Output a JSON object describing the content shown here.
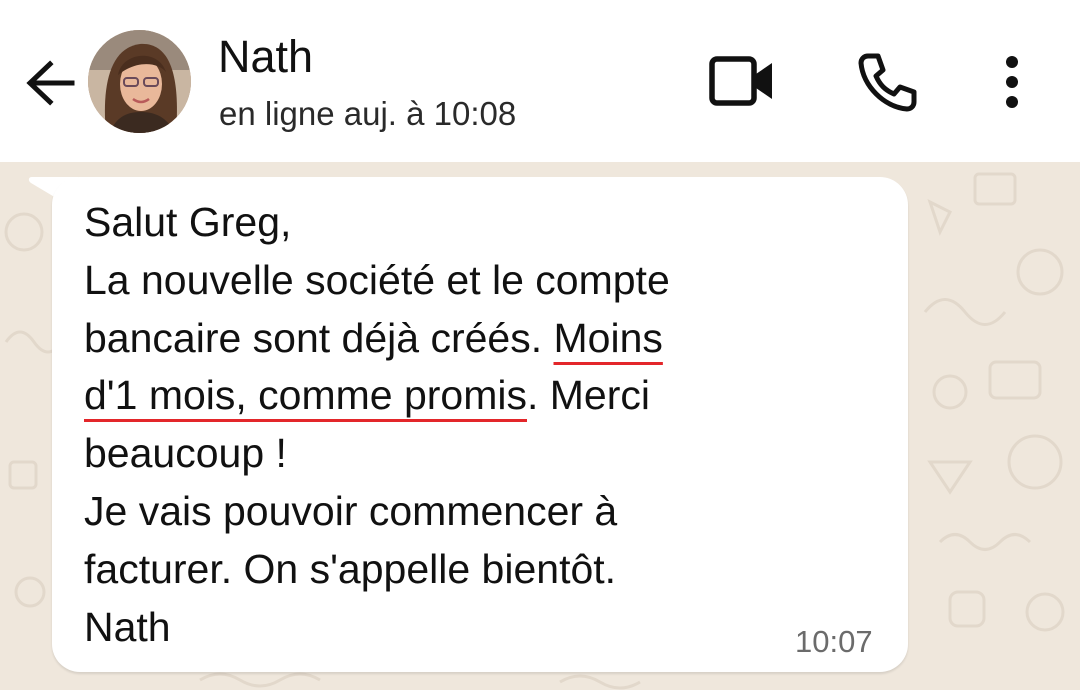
{
  "header": {
    "contact_name": "Nath",
    "status": "en ligne auj. à 10:08",
    "icons": [
      "arrow-left-icon",
      "avatar",
      "video-camera-icon",
      "phone-icon",
      "kebab-menu-icon"
    ]
  },
  "message": {
    "lines": [
      {
        "text": "Salut Greg,"
      },
      {
        "text": "La nouvelle société et le compte"
      },
      {
        "before": "bancaire sont déjà créés. ",
        "highlight": "Moins",
        "after": ""
      },
      {
        "before": "",
        "highlight": "d'1 mois, comme promis",
        "after": ". Merci"
      },
      {
        "text": "beaucoup !"
      },
      {
        "text": "Je vais pouvoir commencer à"
      },
      {
        "text": "facturer. On s'appelle bientôt."
      },
      {
        "text": "Nath"
      }
    ],
    "time": "10:07",
    "highlight_color": "#e3262a"
  },
  "colors": {
    "chat_background": "#efe7dc",
    "bubble": "#ffffff",
    "header": "#ffffff"
  }
}
